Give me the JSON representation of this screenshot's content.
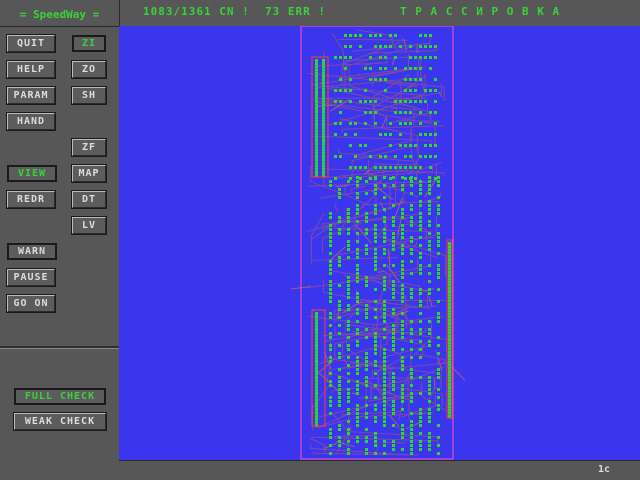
{
  "app": {
    "title": "= SpeedWay ="
  },
  "header": {
    "status": "1083/1361 CN !  73 ERR !",
    "mode": "Т Р А С С И Р О В К А"
  },
  "footer": {
    "layer": "1c"
  },
  "buttons": {
    "quit": "QUIT",
    "help": "HELP",
    "param": "PARAM",
    "hand": "HAND",
    "zi": "ZI",
    "zo": "ZO",
    "sh": "SH",
    "zf": "ZF",
    "view": "VIEW",
    "map": "MAP",
    "redr": "REDR",
    "dt": "DT",
    "lv": "LV",
    "warn": "WARN",
    "pause": "PAUSE",
    "go_on": "GO ON",
    "full_check": "FULL CHECK",
    "weak_check": "WEAK CHECK"
  },
  "colors": {
    "canvas_bg": "#3b35ee",
    "board_outline": "#ff4fc8",
    "trace": "#7a4aa8",
    "pad": "#2dd82d",
    "accent_text": "#3ad23a"
  }
}
